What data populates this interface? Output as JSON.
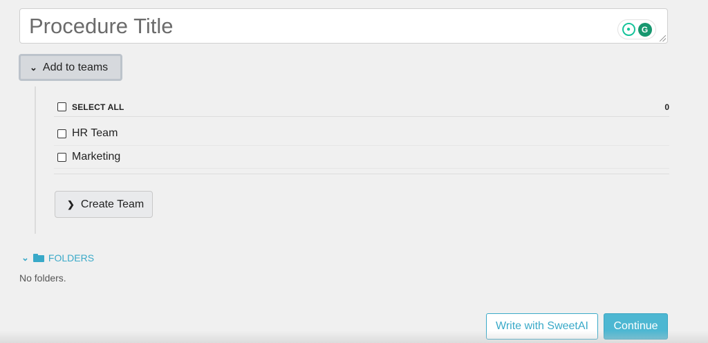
{
  "title_field": {
    "placeholder": "Procedure Title",
    "value": ""
  },
  "grammarly": {
    "bulb_icon": "lightbulb-icon",
    "logo_icon": "grammarly-g-icon",
    "logo_letter": "G"
  },
  "teams": {
    "toggle_label": "Add to teams",
    "toggle_icon": "chevron-down-icon",
    "select_all_label": "SELECT ALL",
    "selected_count": "0",
    "items": [
      {
        "label": "HR Team",
        "checked": false
      },
      {
        "label": "Marketing",
        "checked": false
      }
    ],
    "create_label": "Create Team",
    "create_icon": "chevron-right-icon"
  },
  "folders": {
    "header_label": "FOLDERS",
    "header_icon": "folder-icon",
    "empty_text": "No folders."
  },
  "actions": {
    "sweetai_label": "Write with SweetAI",
    "continue_label": "Continue"
  },
  "colors": {
    "accent": "#39a9c8",
    "continue_bg": "#4db7d2",
    "grammarly_green": "#17976f"
  }
}
